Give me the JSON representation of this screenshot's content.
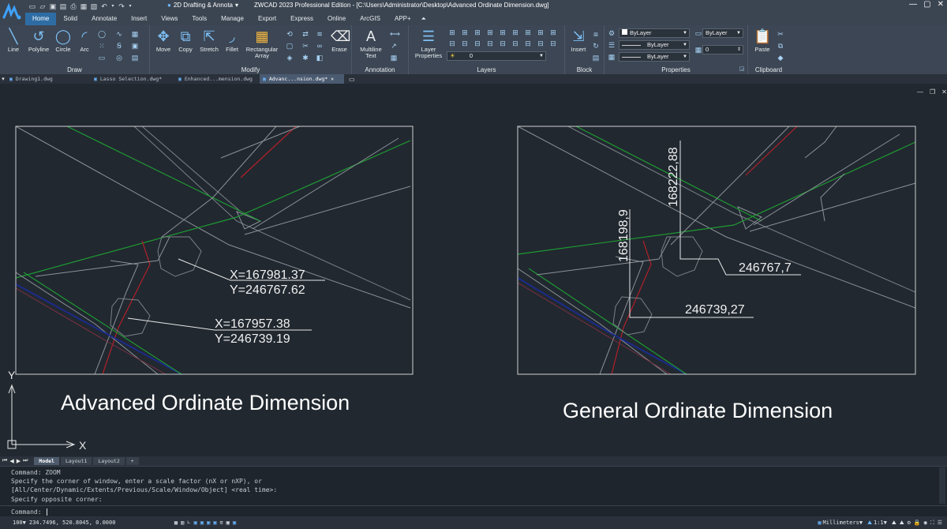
{
  "app": {
    "window_title": "ZWCAD 2023 Professional Edition - [C:\\Users\\Administrator\\Desktop\\Advanced Ordinate Dimension.dwg]",
    "workspace": "2D Drafting & Annota",
    "accent": "#2e6da4"
  },
  "quick_access": [
    "new-icon",
    "open-icon",
    "save-icon",
    "save-as-icon",
    "print-icon",
    "plot-preview-icon",
    "undo-icon",
    "redo-icon"
  ],
  "ribbon_tabs": [
    "Home",
    "Solid",
    "Annotate",
    "Insert",
    "Views",
    "Tools",
    "Manage",
    "Export",
    "Express",
    "Online",
    "ArcGIS",
    "APP+"
  ],
  "ribbon": {
    "draw": {
      "label": "Draw",
      "buttons": [
        "Line",
        "Polyline",
        "Circle",
        "Arc"
      ]
    },
    "modify": {
      "label": "Modify",
      "buttons": [
        "Move",
        "Copy",
        "Stretch",
        "Fillet",
        "Rectangular Array",
        "Erase"
      ]
    },
    "annotation": {
      "label": "Annotation",
      "buttons": [
        "Multiline Text"
      ]
    },
    "layers": {
      "label": "Layers",
      "layer_properties": "Layer Properties",
      "current_layer": "0"
    },
    "block": {
      "label": "Block",
      "insert": "Insert"
    },
    "properties": {
      "label": "Properties",
      "color": "ByLayer",
      "linetype": "ByLayer",
      "lineweight": "ByLayer",
      "plotstyle": "ByLayer",
      "transparency": "0"
    },
    "clipboard": {
      "label": "Clipboard",
      "paste": "Paste"
    }
  },
  "doc_tabs": [
    {
      "label": "Drawing1.dwg",
      "active": false
    },
    {
      "label": "Lasso Selection.dwg*",
      "active": false
    },
    {
      "label": "Enhanced...mension.dwg",
      "active": false
    },
    {
      "label": "Advanc...nsion.dwg*",
      "active": true
    }
  ],
  "drawing": {
    "left_caption": "Advanced Ordinate Dimension",
    "right_caption": "General Ordinate Dimension",
    "left_dims": [
      {
        "x": "X=167981.37",
        "y": "Y=246767.62"
      },
      {
        "x": "X=167957.38",
        "y": "Y=246739.19"
      }
    ],
    "right_dims": {
      "vert1": "168222,88",
      "vert2": "168198,9",
      "horiz1": "246767,7",
      "horiz2": "246739,27"
    },
    "ucs_x": "X",
    "ucs_y": "Y"
  },
  "layout_tabs": [
    {
      "label": "Model",
      "active": true
    },
    {
      "label": "Layout1",
      "active": false
    },
    {
      "label": "Layout2",
      "active": false
    },
    {
      "label": "+",
      "active": false
    }
  ],
  "command_history": [
    "Command: ZOOM",
    "Specify the corner of window, enter a scale factor (nX or nXP), or",
    "[All/Center/Dynamic/Extents/Previous/Scale/Window/Object] <real time>:",
    "Specify opposite corner:"
  ],
  "command_prompt": "Command:",
  "status": {
    "zoom": "100",
    "coords": "234.7496, 520.8045, 0.0000",
    "units": "Millimeters",
    "scale": "1:1"
  }
}
